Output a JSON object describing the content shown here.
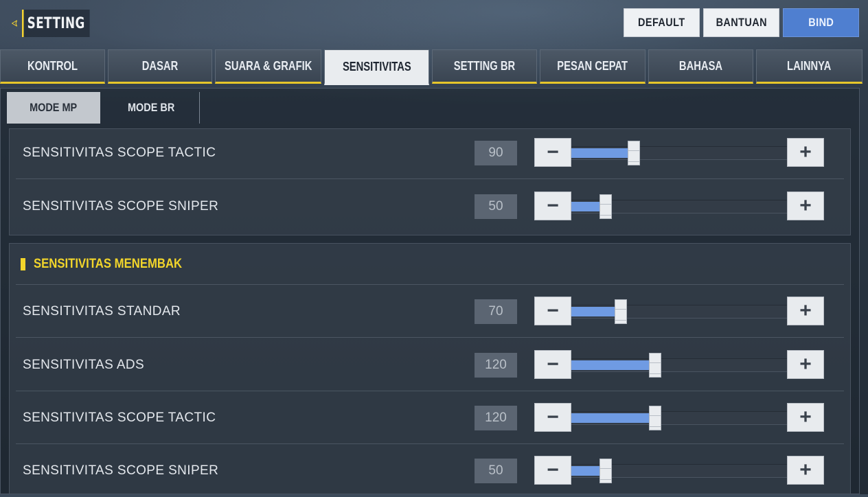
{
  "header": {
    "title": "SETTING",
    "buttons": {
      "default": "DEFAULT",
      "bantuan": "BANTUAN",
      "bind": "BIND"
    }
  },
  "tabs": [
    {
      "label": "KONTROL",
      "active": false
    },
    {
      "label": "DASAR",
      "active": false
    },
    {
      "label": "SUARA & GRAFIK",
      "active": false
    },
    {
      "label": "SENSITIVITAS",
      "active": true
    },
    {
      "label": "SETTING BR",
      "active": false
    },
    {
      "label": "PESAN CEPAT",
      "active": false
    },
    {
      "label": "BAHASA",
      "active": false
    },
    {
      "label": "LAINNYA",
      "active": false
    }
  ],
  "subtabs": [
    {
      "label": "MODE MP",
      "active": true
    },
    {
      "label": "MODE BR",
      "active": false
    }
  ],
  "scope_group": {
    "rows": [
      {
        "label": "SENSITIVITAS SCOPE TACTIC",
        "value": "90",
        "level": 0.29
      },
      {
        "label": "SENSITIVITAS SCOPE SNIPER",
        "value": "50",
        "level": 0.16
      }
    ]
  },
  "fire_group": {
    "title": "SENSITIVITAS MENEMBAK",
    "rows": [
      {
        "label": "SENSITIVITAS STANDAR",
        "value": "70",
        "level": 0.23
      },
      {
        "label": "SENSITIVITAS ADS",
        "value": "120",
        "level": 0.39
      },
      {
        "label": "SENSITIVITAS SCOPE TACTIC",
        "value": "120",
        "level": 0.39
      },
      {
        "label": "SENSITIVITAS SCOPE SNIPER",
        "value": "50",
        "level": 0.16
      }
    ]
  },
  "controls": {
    "minus": "−",
    "plus": "+"
  },
  "colors": {
    "accent_yellow": "#f2d52b",
    "accent_blue": "#4f7fd0",
    "slider_fill": "#6f9be3"
  }
}
